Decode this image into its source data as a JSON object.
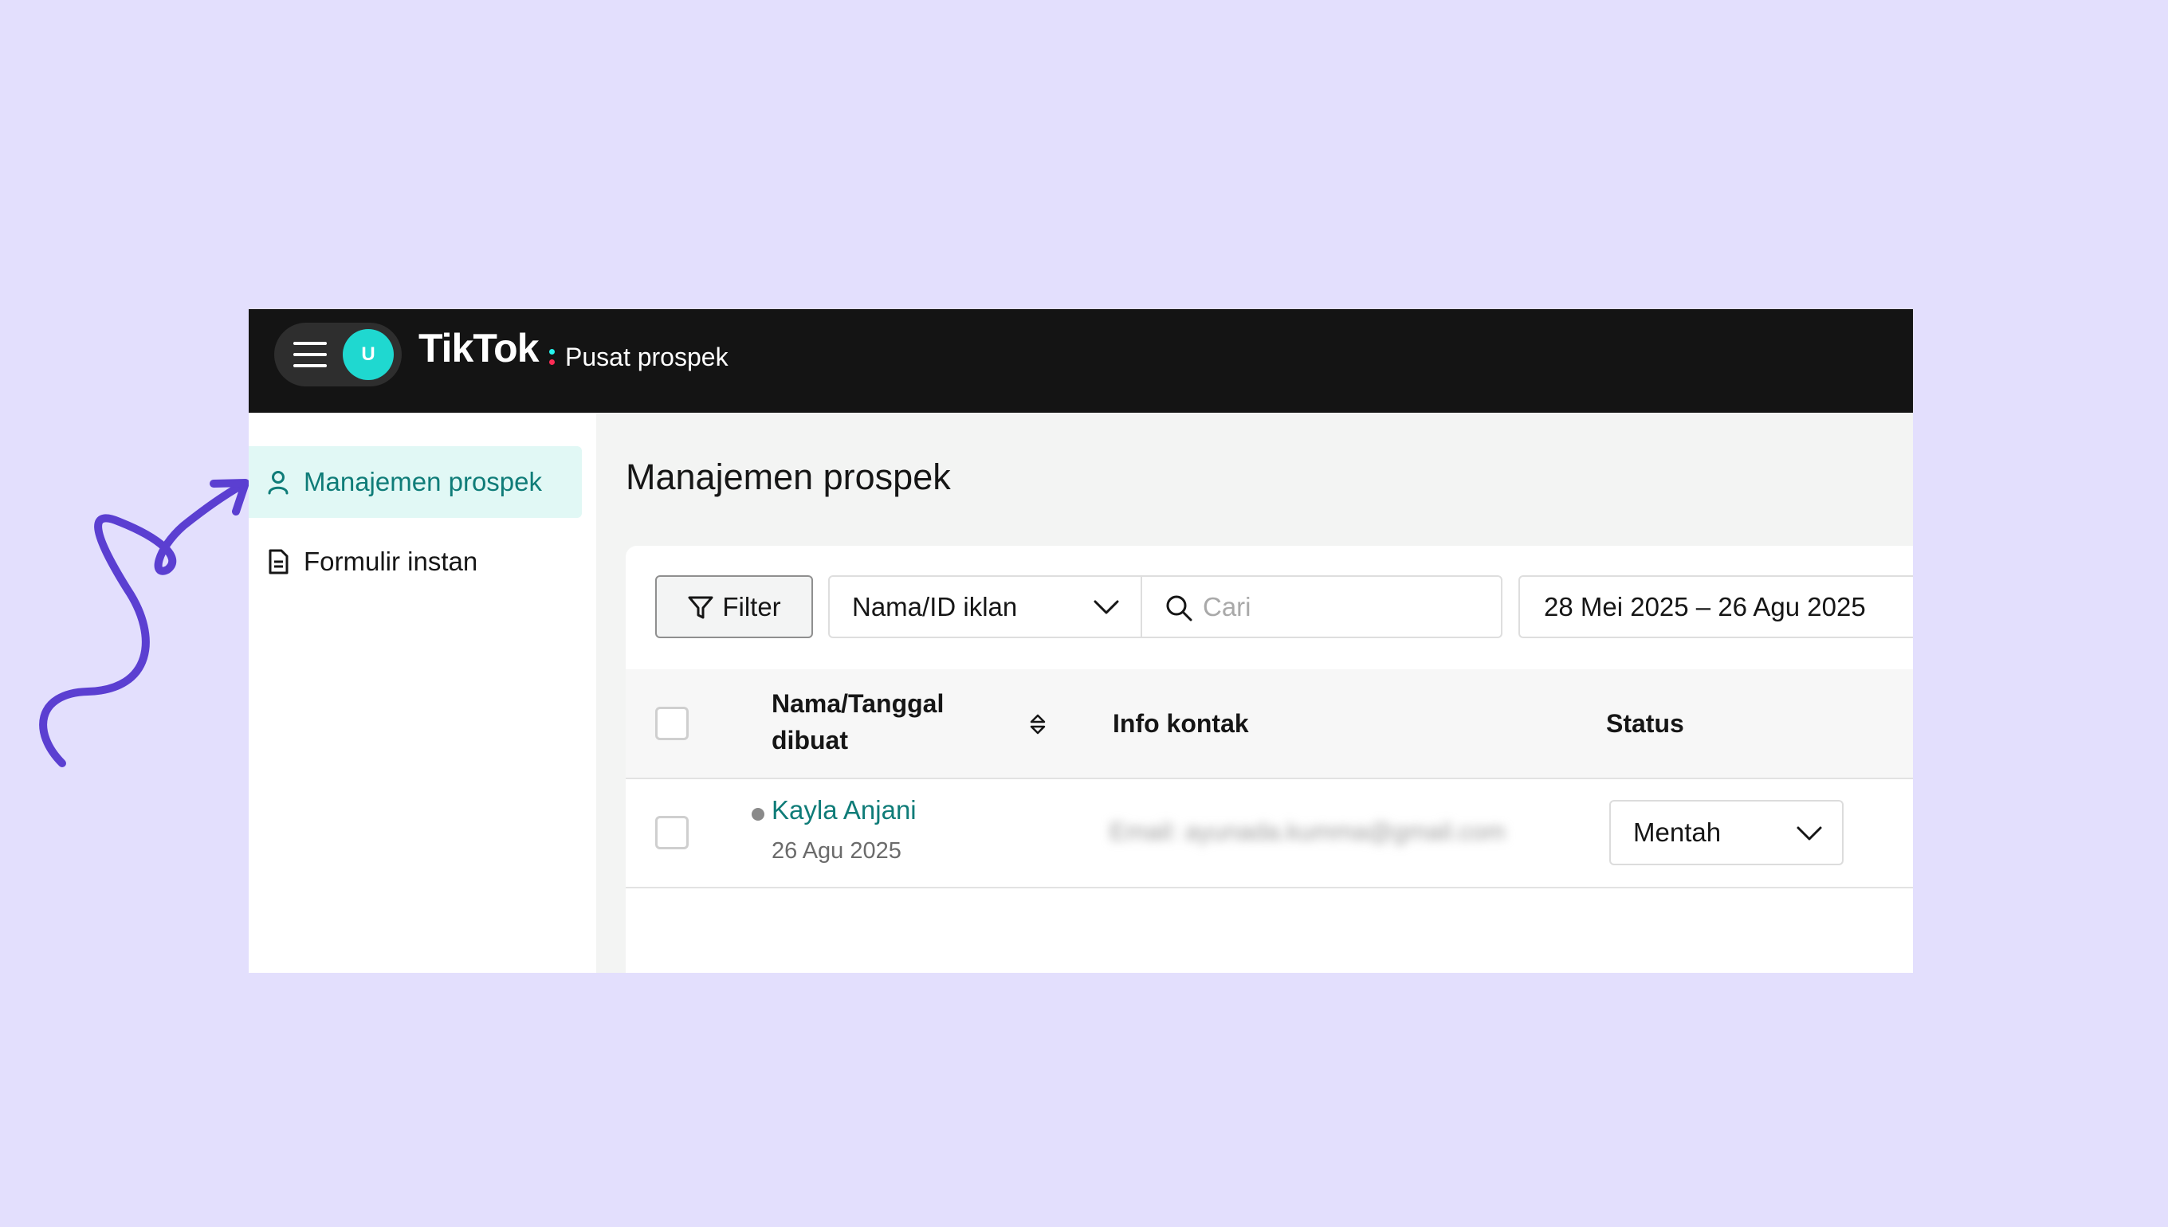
{
  "header": {
    "avatar_initial": "U",
    "logo_text": "TikTok",
    "app_name": "Pusat prospek"
  },
  "sidebar": {
    "items": [
      {
        "label": "Manajemen prospek",
        "icon": "user-icon",
        "active": true
      },
      {
        "label": "Formulir instan",
        "icon": "document-icon",
        "active": false
      }
    ]
  },
  "main": {
    "title": "Manajemen prospek",
    "toolbar": {
      "filter_label": "Filter",
      "select_value": "Nama/ID iklan",
      "search_placeholder": "Cari",
      "date_range": "28 Mei 2025 – 26 Agu 2025"
    },
    "table": {
      "columns": [
        "Nama/Tanggal dibuat",
        "Info kontak",
        "Status"
      ],
      "column_name_line1": "Nama/Tanggal",
      "column_name_line2": "dibuat",
      "rows": [
        {
          "name": "Kayla Anjani",
          "date": "26 Agu 2025",
          "contact": "Email: ayunada.kumma@gmail.com",
          "status": "Mentah"
        }
      ]
    }
  },
  "colors": {
    "background": "#e3dffd",
    "topbar": "#141414",
    "accent_teal": "#0f7c78",
    "active_bg": "#e1f8f5",
    "annotation_arrow": "#5b3fd1"
  }
}
